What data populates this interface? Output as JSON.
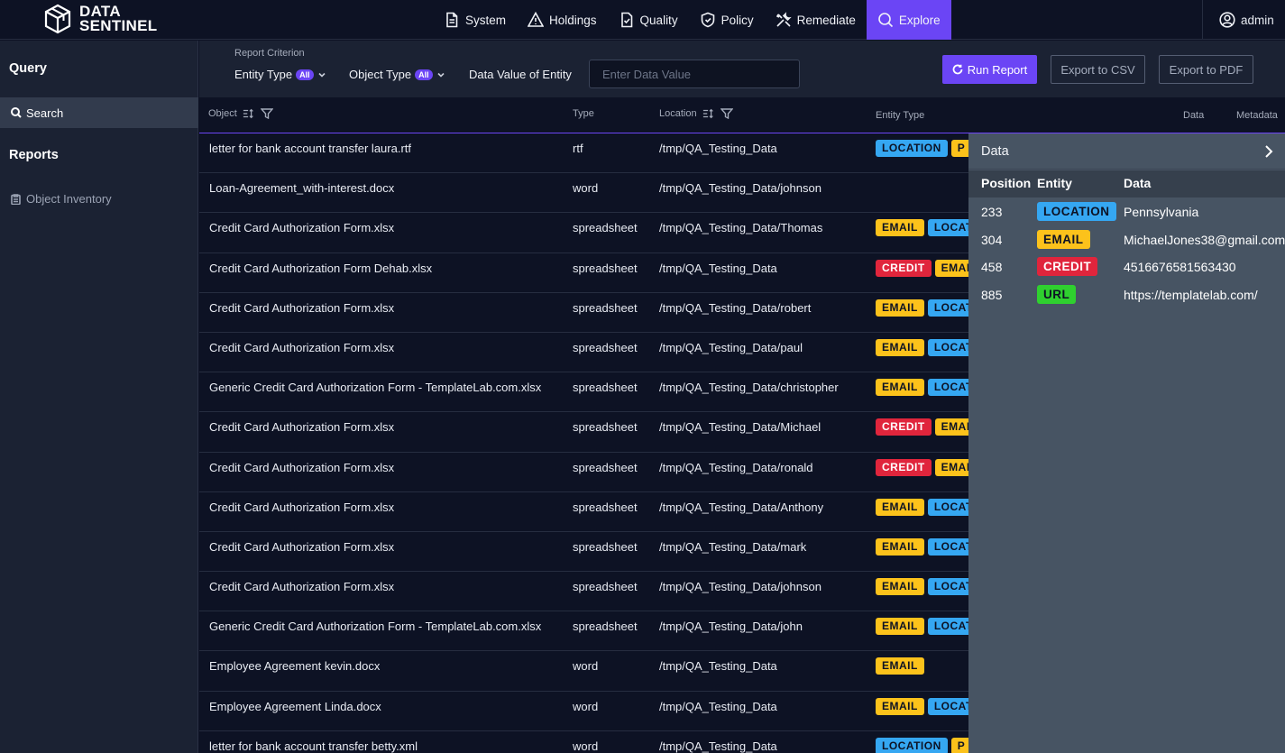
{
  "brand": {
    "line1": "DATA",
    "line2": "SENTINEL"
  },
  "nav": [
    {
      "label": "System",
      "icon": "document-icon"
    },
    {
      "label": "Holdings",
      "icon": "warning-triangle-icon"
    },
    {
      "label": "Quality",
      "icon": "quality-check-icon"
    },
    {
      "label": "Policy",
      "icon": "shield-icon"
    },
    {
      "label": "Remediate",
      "icon": "tools-icon"
    },
    {
      "label": "Explore",
      "icon": "search-icon",
      "active": true
    }
  ],
  "user": {
    "name": "admin"
  },
  "sidebar": {
    "query_heading": "Query",
    "search_label": "Search",
    "reports_heading": "Reports",
    "object_inventory_label": "Object Inventory"
  },
  "criteria": {
    "label": "Report Criterion",
    "entity_type": "Entity Type",
    "entity_type_badge": "All",
    "object_type": "Object Type",
    "object_type_badge": "All",
    "data_value_label": "Data Value of Entity",
    "data_value_placeholder": "Enter Data Value",
    "data_value": ""
  },
  "actions": {
    "run": "Run Report",
    "export_csv": "Export to CSV",
    "export_pdf": "Export to PDF"
  },
  "columns": {
    "object": "Object",
    "type": "Type",
    "location": "Location",
    "entity_type": "Entity Type",
    "data": "Data",
    "metadata": "Metadata"
  },
  "rows": [
    {
      "object": "letter for bank account transfer laura.rtf",
      "type": "rtf",
      "location": "/tmp/QA_Testing_Data",
      "entities": [
        "LOCATION",
        "P"
      ]
    },
    {
      "object": "Loan-Agreement_with-interest.docx",
      "type": "word",
      "location": "/tmp/QA_Testing_Data/johnson",
      "entities": []
    },
    {
      "object": "Credit Card Authorization Form.xlsx",
      "type": "spreadsheet",
      "location": "/tmp/QA_Testing_Data/Thomas",
      "entities": [
        "EMAIL",
        "LOCATION"
      ]
    },
    {
      "object": "Credit Card Authorization Form Dehab.xlsx",
      "type": "spreadsheet",
      "location": "/tmp/QA_Testing_Data",
      "entities": [
        "CREDIT",
        "EMAIL"
      ]
    },
    {
      "object": "Credit Card Authorization Form.xlsx",
      "type": "spreadsheet",
      "location": "/tmp/QA_Testing_Data/robert",
      "entities": [
        "EMAIL",
        "LOCATION"
      ]
    },
    {
      "object": "Credit Card Authorization Form.xlsx",
      "type": "spreadsheet",
      "location": "/tmp/QA_Testing_Data/paul",
      "entities": [
        "EMAIL",
        "LOCATION"
      ]
    },
    {
      "object": "Generic Credit Card Authorization Form - TemplateLab.com.xlsx",
      "type": "spreadsheet",
      "location": "/tmp/QA_Testing_Data/christopher",
      "entities": [
        "EMAIL",
        "LOCATION"
      ]
    },
    {
      "object": "Credit Card Authorization Form.xlsx",
      "type": "spreadsheet",
      "location": "/tmp/QA_Testing_Data/Michael",
      "entities": [
        "CREDIT",
        "EMAIL"
      ]
    },
    {
      "object": "Credit Card Authorization Form.xlsx",
      "type": "spreadsheet",
      "location": "/tmp/QA_Testing_Data/ronald",
      "entities": [
        "CREDIT",
        "EMAIL"
      ]
    },
    {
      "object": "Credit Card Authorization Form.xlsx",
      "type": "spreadsheet",
      "location": "/tmp/QA_Testing_Data/Anthony",
      "entities": [
        "EMAIL",
        "LOCATION"
      ]
    },
    {
      "object": "Credit Card Authorization Form.xlsx",
      "type": "spreadsheet",
      "location": "/tmp/QA_Testing_Data/mark",
      "entities": [
        "EMAIL",
        "LOCATION"
      ]
    },
    {
      "object": "Credit Card Authorization Form.xlsx",
      "type": "spreadsheet",
      "location": "/tmp/QA_Testing_Data/johnson",
      "entities": [
        "EMAIL",
        "LOCATION"
      ]
    },
    {
      "object": "Generic Credit Card Authorization Form - TemplateLab.com.xlsx",
      "type": "spreadsheet",
      "location": "/tmp/QA_Testing_Data/john",
      "entities": [
        "EMAIL",
        "LOCATION"
      ]
    },
    {
      "object": "Employee Agreement kevin.docx",
      "type": "word",
      "location": "/tmp/QA_Testing_Data",
      "entities": [
        "EMAIL"
      ]
    },
    {
      "object": "Employee Agreement Linda.docx",
      "type": "word",
      "location": "/tmp/QA_Testing_Data",
      "entities": [
        "EMAIL",
        "LOCATION"
      ]
    },
    {
      "object": "letter for bank account transfer betty.xml",
      "type": "word",
      "location": "/tmp/QA_Testing_Data",
      "entities": [
        "LOCATION",
        "P"
      ]
    }
  ],
  "panel": {
    "title": "Data",
    "columns": {
      "position": "Position",
      "entity": "Entity",
      "data": "Data"
    },
    "rows": [
      {
        "position": "233",
        "entity": "LOCATION",
        "data": "Pennsylvania"
      },
      {
        "position": "304",
        "entity": "EMAIL",
        "data": "MichaelJones38@gmail.com"
      },
      {
        "position": "458",
        "entity": "CREDIT",
        "data": "4516676581563430"
      },
      {
        "position": "885",
        "entity": "URL",
        "data": "https://templatelab.com/"
      }
    ]
  },
  "colors": {
    "accent": "#6b45f5",
    "LOCATION": "#35a7f2",
    "EMAIL": "#fcc21b",
    "CREDIT": "#e0253c",
    "URL": "#2fd02f"
  }
}
